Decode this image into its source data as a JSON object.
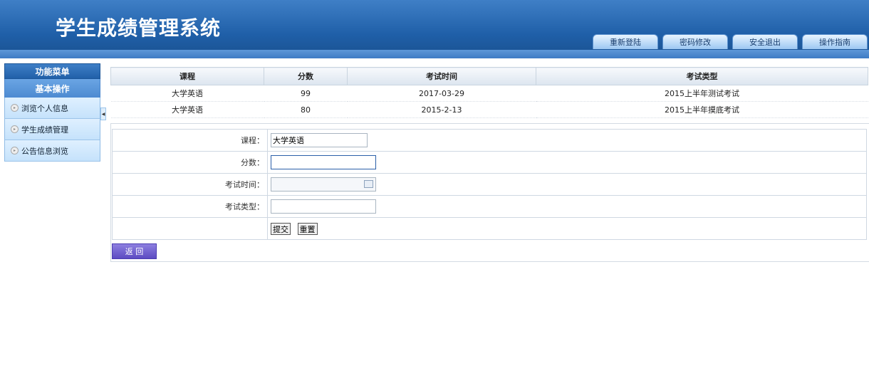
{
  "header": {
    "title": "学生成绩管理系统",
    "nav": [
      "重新登陆",
      "密码修改",
      "安全退出",
      "操作指南"
    ]
  },
  "sidebar": {
    "menu_title": "功能菜单",
    "section_title": "基本操作",
    "items": [
      "浏览个人信息",
      "学生成绩管理",
      "公告信息浏览"
    ]
  },
  "scores": {
    "headers": [
      "课程",
      "分数",
      "考试时间",
      "考试类型"
    ],
    "rows": [
      [
        "大学英语",
        "99",
        "2017-03-29",
        "2015上半年测试考试"
      ],
      [
        "大学英语",
        "80",
        "2015-2-13",
        "2015上半年摸底考试"
      ]
    ]
  },
  "form": {
    "course_label": "课程：",
    "course_value": "大学英语",
    "score_label": "分数：",
    "score_value": "",
    "date_label": "考试时间：",
    "date_value": "",
    "type_label": "考试类型：",
    "type_value": "",
    "submit_label": "提交",
    "reset_label": "重置"
  },
  "back_label": "返 回",
  "colors": {
    "header_blue": "#1f5fa8",
    "sidebar_item": "#c5e2fb",
    "back_button": "#5c4bc2"
  }
}
